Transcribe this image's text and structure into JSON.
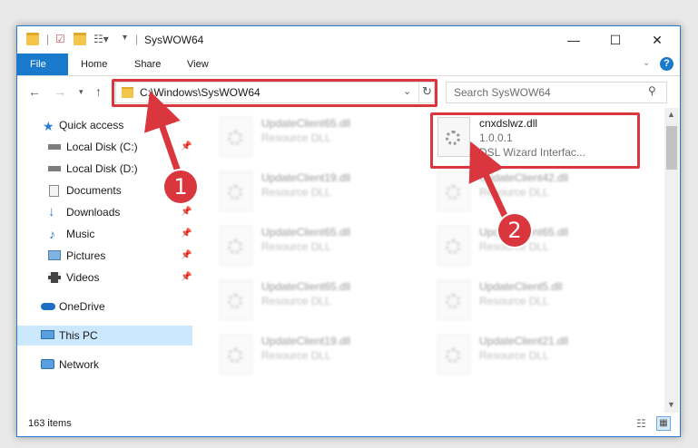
{
  "window": {
    "title": "SysWOW64"
  },
  "ribbon": {
    "tabs": [
      "File",
      "Home",
      "Share",
      "View"
    ]
  },
  "address": {
    "path": "C:\\Windows\\SysWOW64"
  },
  "search": {
    "placeholder": "Search SysWOW64"
  },
  "sidebar": {
    "items": [
      {
        "label": "Quick access",
        "icon": "star-icon"
      },
      {
        "label": "Local Disk (C:)",
        "icon": "drive-icon",
        "pinned": true
      },
      {
        "label": "Local Disk (D:)",
        "icon": "drive-icon"
      },
      {
        "label": "Documents",
        "icon": "documents-icon"
      },
      {
        "label": "Downloads",
        "icon": "downloads-icon",
        "pinned": true
      },
      {
        "label": "Music",
        "icon": "music-icon",
        "pinned": true
      },
      {
        "label": "Pictures",
        "icon": "pictures-icon",
        "pinned": true
      },
      {
        "label": "Videos",
        "icon": "videos-icon",
        "pinned": true
      },
      {
        "label": "OneDrive",
        "icon": "onedrive-icon"
      },
      {
        "label": "This PC",
        "icon": "pc-icon",
        "selected": true
      },
      {
        "label": "Network",
        "icon": "network-icon"
      }
    ]
  },
  "files": {
    "highlighted": {
      "name": "cnxdslwz.dll",
      "version": "1.0.0.1",
      "description": "DSL Wizard Interfac..."
    },
    "col1": [
      {
        "name": "UpdateClient65.dll",
        "type": "Resource DLL"
      },
      {
        "name": "UpdateClient19.dll",
        "type": "Resource DLL"
      },
      {
        "name": "UpdateClient65.dll",
        "type": "Resource DLL"
      },
      {
        "name": "UpdateClient65.dll",
        "type": "Resource DLL"
      },
      {
        "name": "UpdateClient19.dll",
        "type": "Resource DLL"
      }
    ],
    "col2": [
      {
        "name": "UpdateClient42.dll",
        "type": "Resource DLL"
      },
      {
        "name": "UpdateClient65.dll",
        "type": "Resource DLL"
      },
      {
        "name": "UpdateClient5.dll",
        "type": "Resource DLL"
      },
      {
        "name": "UpdateClient21.dll",
        "type": "Resource DLL"
      }
    ]
  },
  "status": {
    "count": "163 items"
  },
  "callouts": {
    "one": "1",
    "two": "2"
  },
  "colors": {
    "accent": "#1979ca",
    "highlight": "#d9363e",
    "selected": "#cce8ff"
  }
}
